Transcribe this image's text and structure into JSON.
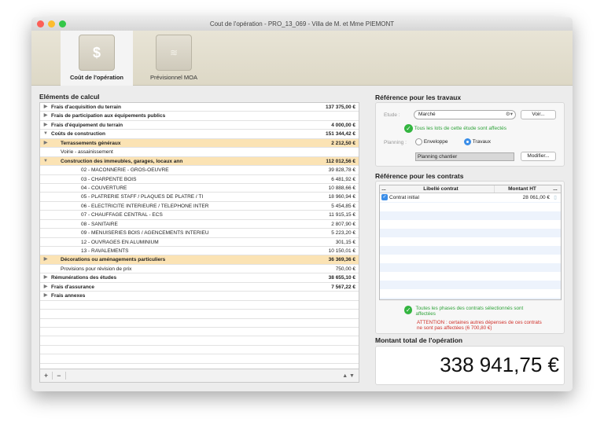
{
  "window": {
    "title": "Cout de l'opération - PRO_13_069 - Villa de M. et Mme PIEMONT"
  },
  "tabs": [
    {
      "label": "Coût de l'opération",
      "icon": "money-bag-icon"
    },
    {
      "label": "Prévisionnel MOA",
      "icon": "chart-icon"
    }
  ],
  "left": {
    "heading": "Eléments de calcul",
    "rows": [
      {
        "label": "Frais d'acquisition du terrain",
        "amount": "137 375,00 €",
        "level": 0,
        "bold": true,
        "toggle": "▶"
      },
      {
        "label": "Frais de participation aux équipements publics",
        "amount": "",
        "level": 0,
        "bold": true,
        "toggle": "▶"
      },
      {
        "label": "Frais d'équipement du terrain",
        "amount": "4 000,00 €",
        "level": 0,
        "bold": true,
        "toggle": "▶"
      },
      {
        "label": "Coûts de construction",
        "amount": "151 344,42 €",
        "level": 0,
        "bold": true,
        "toggle": "▼"
      },
      {
        "label": "Terrassements généraux",
        "amount": "2 212,50 €",
        "level": 1,
        "bold": true,
        "hl": true,
        "toggle": "▶"
      },
      {
        "label": "Voirie - assainissement",
        "amount": "",
        "level": 1,
        "bold": false,
        "toggle": ""
      },
      {
        "label": "Construction des immeubles, garages, locaux ann",
        "amount": "112 012,56 €",
        "level": 1,
        "bold": true,
        "hl": true,
        "toggle": "▼"
      },
      {
        "label": "02 - MACONNERIE - GROS-OEUVRE",
        "amount": "39 828,78 €",
        "level": 2
      },
      {
        "label": "03 - CHARPENTE BOIS",
        "amount": "6 481,92 €",
        "level": 2
      },
      {
        "label": "04 - COUVERTURE",
        "amount": "10 888,66 €",
        "level": 2
      },
      {
        "label": "05 - PLATRERIE  STAFF / PLAQUES DE PLATRE / TI",
        "amount": "18 960,94 €",
        "level": 2
      },
      {
        "label": "06 - ELECTRICITE INTERIEURE / TELEPHONE INTER",
        "amount": "5 454,85 €",
        "level": 2
      },
      {
        "label": "07 - CHAUFFAGE CENTRAL - ECS",
        "amount": "11 915,15 €",
        "level": 2
      },
      {
        "label": "08 - SANITAIRE",
        "amount": "2 807,90 €",
        "level": 2
      },
      {
        "label": "09 - MENUISERIES BOIS / AGENCEMENTS INTERIEU",
        "amount": "5 223,20 €",
        "level": 2
      },
      {
        "label": "12 - OUVRAGES EN ALUMINIUM",
        "amount": "301,15 €",
        "level": 2
      },
      {
        "label": "13 - RAVALEMENTS",
        "amount": "10 150,01 €",
        "level": 2
      },
      {
        "label": "Décorations ou aménagements particuliers",
        "amount": "36 369,36 €",
        "level": 1,
        "bold": true,
        "hl": true,
        "toggle": "▶"
      },
      {
        "label": "Provisions pour révision de prix",
        "amount": "750,00 €",
        "level": 1
      },
      {
        "label": "Rémunérations des études",
        "amount": "38 655,10 €",
        "level": 0,
        "bold": true,
        "toggle": "▶"
      },
      {
        "label": "Frais d'assurance",
        "amount": "7 567,22 €",
        "level": 0,
        "bold": true,
        "toggle": "▶"
      },
      {
        "label": "Frais annexes",
        "amount": "",
        "level": 0,
        "bold": true,
        "toggle": "▶"
      }
    ],
    "add_label": "+",
    "remove_label": "−"
  },
  "travaux": {
    "heading": "Référence pour les travaux",
    "etude_label": "Etude :",
    "etude_value": "Marché",
    "voir_label": "Voir...",
    "status": "Tous les lots de cette étude sont affectés",
    "planning_label": "Planning :",
    "radio_enveloppe": "Enveloppe",
    "radio_travaux": "Travaux",
    "selected": "Travaux",
    "planning_value": "Planning chantier",
    "modifier_label": "Modifier..."
  },
  "contrats": {
    "heading": "Référence pour les contrats",
    "columns": [
      "...",
      "Libellé contrat",
      "Montant HT",
      "..."
    ],
    "rows": [
      {
        "checked": true,
        "label": "Contrat initial",
        "amount": "28 061,00 €"
      }
    ],
    "status": "Toutes les phases des contrats sélectionnés sont affectées",
    "warning": "ATTENTION : certaines autres dépenses de ces contrats ne sont pas affectées (6 700,80 €)"
  },
  "total": {
    "heading": "Montant total de l'opération",
    "value": "338 941,75 €"
  },
  "colors": {
    "highlight": "#fbe3b4",
    "success": "#2fa33a",
    "warning": "#d0302a",
    "selection": "#3b8ee8"
  }
}
